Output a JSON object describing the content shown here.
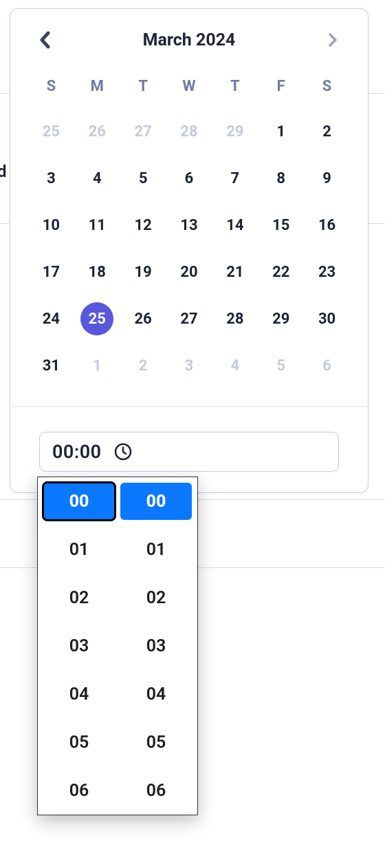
{
  "background": {
    "partial_label": "d"
  },
  "calendar": {
    "title": "March 2024",
    "weekdays": [
      "S",
      "M",
      "T",
      "W",
      "T",
      "F",
      "S"
    ],
    "selected_day": 25,
    "prev_days": [
      25,
      26,
      27,
      28,
      29
    ],
    "days": [
      1,
      2,
      3,
      4,
      5,
      6,
      7,
      8,
      9,
      10,
      11,
      12,
      13,
      14,
      15,
      16,
      17,
      18,
      19,
      20,
      21,
      22,
      23,
      24,
      25,
      26,
      27,
      28,
      29,
      30,
      31
    ],
    "next_days": [
      1,
      2,
      3,
      4,
      5,
      6
    ]
  },
  "time": {
    "value": "00:00",
    "hours": [
      "00",
      "01",
      "02",
      "03",
      "04",
      "05",
      "06"
    ],
    "minutes": [
      "00",
      "01",
      "02",
      "03",
      "04",
      "05",
      "06"
    ],
    "selected_hour": "00",
    "selected_minute": "00"
  }
}
